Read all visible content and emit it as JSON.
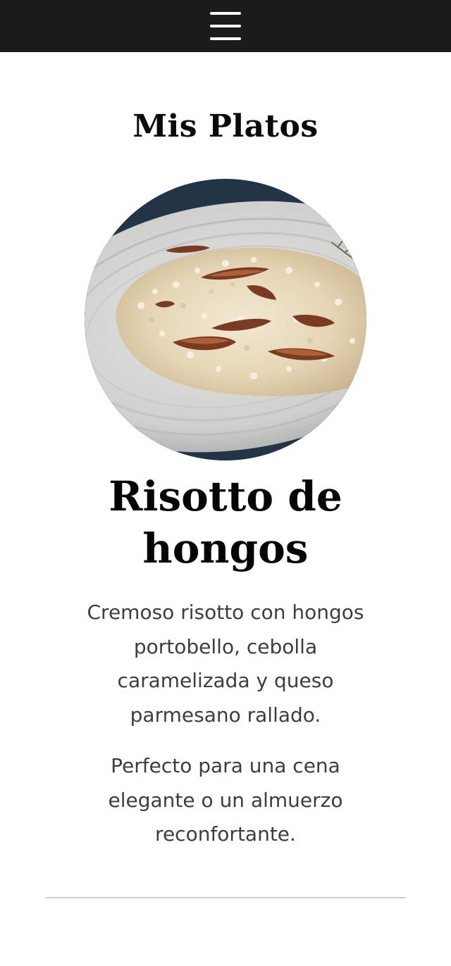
{
  "header": {
    "menu_icon": "hamburger-menu-icon",
    "background_color": "#1b1b1b"
  },
  "section": {
    "title": "Mis Platos"
  },
  "dish": {
    "image_alt": "Risotto de hongos en un plato",
    "name_lines": [
      "Risotto de",
      "hongos"
    ],
    "description_lines": [
      "Cremoso risotto con hongos",
      "portobello, cebolla",
      "caramelizada y queso",
      "parmesano rallado."
    ],
    "note_lines": [
      "Perfecto para una cena",
      "elegante o un almuerzo",
      "reconfortante."
    ]
  }
}
